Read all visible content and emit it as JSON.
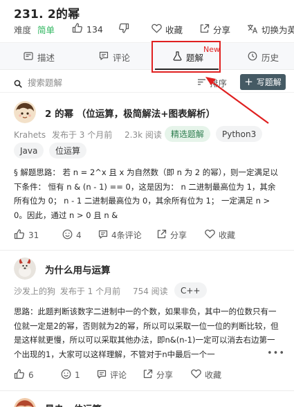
{
  "problem": {
    "title": "231. 2的幂",
    "difficulty_label": "难度",
    "difficulty_value": "简单",
    "likes": "134",
    "favorite_label": "收藏",
    "share_label": "分享",
    "switch_label": "切换为英文"
  },
  "tabs": [
    {
      "label": "描述"
    },
    {
      "label": "评论"
    },
    {
      "label": "题解"
    },
    {
      "label": "历史"
    }
  ],
  "new_badge": "New",
  "search": {
    "placeholder": "搜索题解",
    "value": ""
  },
  "sort_label": "排序",
  "write_label": "写题解",
  "posts": [
    {
      "title": "2 的幂 （位运算，极简解法+图表解析）",
      "author": "Krahets",
      "published": "发布于 3 个月前",
      "views": "2.3k 阅读",
      "tags": [
        "精选题解",
        "Python3",
        "Java",
        "位运算"
      ],
      "body": "§ 解题思路： 若 n = 2^x 且 x 为自然数（即 n 为 2 的幂），则一定满足以下条件： 恒有 n & (n - 1) == 0，这是因为： n 二进制最高位为 1，其余所有位为 0； n - 1 二进制最高位为 0，其余所有位为 1； 一定满足 n > 0。因此，通过 n > 0 且 n &",
      "likes": "31",
      "emoji": "4",
      "comments": "4条评论",
      "share": "分享",
      "favorite": "收藏"
    },
    {
      "title": "为什么用与运算",
      "author": "沙发上的狗",
      "published": "发布于 1 个月前",
      "views": "754 阅读",
      "tags": [
        "C++"
      ],
      "body": "思路：此题判断该数字二进制中一的个数，如果非负，其中一的位数只有一位就一定是2的幂，否则就为2的幂，所以可以采取一位一位的判断比较，但是这样就更慢，所以可以采取其他办法，即n&(n-1)一定可以消去右边第一个出现的1，大家可以这样理解，不管对于n中最后一个一",
      "likes": "6",
      "emoji": "1",
      "comments": "评论",
      "share": "分享",
      "favorite": "收藏"
    },
    {
      "title": "最夬 · 位运算"
    }
  ],
  "colors": {
    "accent_red": "#e02020",
    "easy_green": "#2db55d",
    "write_btn": "#455a64"
  }
}
